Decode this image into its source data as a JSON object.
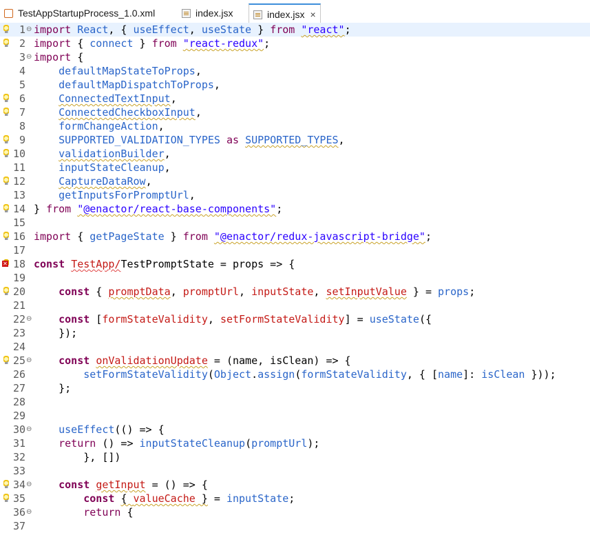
{
  "tabs": [
    {
      "label": "TestAppStartupProcess_1.0.xml",
      "icon": "xml-file-icon",
      "active": false
    },
    {
      "label": "index.jsx",
      "icon": "jsx-file-icon",
      "active": false
    },
    {
      "label": "index.jsx",
      "icon": "jsx-file-icon",
      "active": true,
      "close": "×"
    }
  ],
  "lines": [
    {
      "n": "1",
      "fold": "⊖",
      "marker": "bulb",
      "tokens": [
        [
          "kwn",
          "import"
        ],
        [
          "pl",
          " "
        ],
        [
          "id",
          "React"
        ],
        [
          "pl",
          ", { "
        ],
        [
          "id",
          "useEffect"
        ],
        [
          "pl",
          ", "
        ],
        [
          "id",
          "useState"
        ],
        [
          "pl",
          " } "
        ],
        [
          "kwn",
          "from"
        ],
        [
          "pl",
          " "
        ],
        [
          "str sq",
          "\"react\""
        ],
        [
          "pl",
          ";"
        ]
      ]
    },
    {
      "n": "2",
      "marker": "bulb",
      "tokens": [
        [
          "kwn",
          "import"
        ],
        [
          "pl",
          " { "
        ],
        [
          "id",
          "connect"
        ],
        [
          "pl",
          " } "
        ],
        [
          "kwn",
          "from"
        ],
        [
          "pl",
          " "
        ],
        [
          "str sq",
          "\"react-redux\""
        ],
        [
          "pl",
          ";"
        ]
      ]
    },
    {
      "n": "3",
      "fold": "⊖",
      "tokens": [
        [
          "kwn",
          "import"
        ],
        [
          "pl",
          " {"
        ]
      ]
    },
    {
      "n": "4",
      "tokens": [
        [
          "pl",
          "    "
        ],
        [
          "id",
          "defaultMapStateToProps"
        ],
        [
          "pl",
          ","
        ]
      ]
    },
    {
      "n": "5",
      "tokens": [
        [
          "pl",
          "    "
        ],
        [
          "id",
          "defaultMapDispatchToProps"
        ],
        [
          "pl",
          ","
        ]
      ]
    },
    {
      "n": "6",
      "marker": "bulb",
      "tokens": [
        [
          "pl",
          "    "
        ],
        [
          "id sq",
          "ConnectedTextInput"
        ],
        [
          "pl",
          ","
        ]
      ]
    },
    {
      "n": "7",
      "marker": "bulb",
      "tokens": [
        [
          "pl",
          "    "
        ],
        [
          "id sq",
          "ConnectedCheckboxInput"
        ],
        [
          "pl",
          ","
        ]
      ]
    },
    {
      "n": "8",
      "tokens": [
        [
          "pl",
          "    "
        ],
        [
          "id",
          "formChangeAction"
        ],
        [
          "pl",
          ","
        ]
      ]
    },
    {
      "n": "9",
      "marker": "bulb",
      "tokens": [
        [
          "pl",
          "    "
        ],
        [
          "id",
          "SUPPORTED_VALIDATION_TYPES"
        ],
        [
          "pl",
          " "
        ],
        [
          "kwn",
          "as"
        ],
        [
          "pl",
          " "
        ],
        [
          "id sq",
          "SUPPORTED_TYPES"
        ],
        [
          "pl",
          ","
        ]
      ]
    },
    {
      "n": "10",
      "marker": "bulb",
      "tokens": [
        [
          "pl",
          "    "
        ],
        [
          "id sq",
          "validationBuilder"
        ],
        [
          "pl",
          ","
        ]
      ]
    },
    {
      "n": "11",
      "tokens": [
        [
          "pl",
          "    "
        ],
        [
          "id",
          "inputStateCleanup"
        ],
        [
          "pl",
          ","
        ]
      ]
    },
    {
      "n": "12",
      "marker": "bulb",
      "tokens": [
        [
          "pl",
          "    "
        ],
        [
          "id sq",
          "CaptureDataRow"
        ],
        [
          "pl",
          ","
        ]
      ]
    },
    {
      "n": "13",
      "tokens": [
        [
          "pl",
          "    "
        ],
        [
          "id",
          "getInputsForPromptUrl"
        ],
        [
          "pl",
          ","
        ]
      ]
    },
    {
      "n": "14",
      "marker": "bulb",
      "tokens": [
        [
          "pl",
          "} "
        ],
        [
          "kwn",
          "from"
        ],
        [
          "pl",
          " "
        ],
        [
          "str sq",
          "\"@enactor/react-base-components\""
        ],
        [
          "pl",
          ";"
        ]
      ]
    },
    {
      "n": "15",
      "tokens": []
    },
    {
      "n": "16",
      "marker": "bulb",
      "tokens": [
        [
          "kwn",
          "import"
        ],
        [
          "pl",
          " { "
        ],
        [
          "id",
          "getPageState"
        ],
        [
          "pl",
          " } "
        ],
        [
          "kwn",
          "from"
        ],
        [
          "pl",
          " "
        ],
        [
          "str sq",
          "\"@enactor/redux-javascript-bridge\""
        ],
        [
          "pl",
          ";"
        ]
      ]
    },
    {
      "n": "17",
      "tokens": []
    },
    {
      "n": "18",
      "marker": "error",
      "tokens": [
        [
          "kw",
          "const"
        ],
        [
          "pl",
          " "
        ],
        [
          "err sqr",
          "TestApp/"
        ],
        [
          "pl",
          "TestPromptState = props => {"
        ]
      ]
    },
    {
      "n": "19",
      "tokens": []
    },
    {
      "n": "20",
      "marker": "bulb",
      "tokens": [
        [
          "pl",
          "    "
        ],
        [
          "kw",
          "const"
        ],
        [
          "pl",
          " { "
        ],
        [
          "err sq",
          "promptData"
        ],
        [
          "pl",
          ", "
        ],
        [
          "err",
          "promptUrl"
        ],
        [
          "pl",
          ", "
        ],
        [
          "err",
          "inputState"
        ],
        [
          "pl",
          ", "
        ],
        [
          "err sq",
          "setInputValue"
        ],
        [
          "pl",
          " } = "
        ],
        [
          "id",
          "props"
        ],
        [
          "pl",
          ";"
        ]
      ]
    },
    {
      "n": "21",
      "tokens": []
    },
    {
      "n": "22",
      "fold": "⊖",
      "tokens": [
        [
          "pl",
          "    "
        ],
        [
          "kw",
          "const"
        ],
        [
          "pl",
          " ["
        ],
        [
          "err",
          "formStateValidity"
        ],
        [
          "pl",
          ", "
        ],
        [
          "err",
          "setFormStateValidity"
        ],
        [
          "pl",
          "] = "
        ],
        [
          "id",
          "useState"
        ],
        [
          "pl",
          "({"
        ]
      ]
    },
    {
      "n": "23",
      "tokens": [
        [
          "pl",
          "    });"
        ]
      ]
    },
    {
      "n": "24",
      "tokens": []
    },
    {
      "n": "25",
      "fold": "⊖",
      "marker": "bulb",
      "tokens": [
        [
          "pl",
          "    "
        ],
        [
          "kw",
          "const"
        ],
        [
          "pl",
          " "
        ],
        [
          "err sq",
          "onValidationUpdate"
        ],
        [
          "pl",
          " = (name, isClean) => {"
        ]
      ]
    },
    {
      "n": "26",
      "tokens": [
        [
          "pl",
          "        "
        ],
        [
          "id",
          "setFormStateValidity"
        ],
        [
          "pl",
          "("
        ],
        [
          "id",
          "Object"
        ],
        [
          "pl",
          "."
        ],
        [
          "id",
          "assign"
        ],
        [
          "pl",
          "("
        ],
        [
          "id",
          "formStateValidity"
        ],
        [
          "pl",
          ", { ["
        ],
        [
          "id",
          "name"
        ],
        [
          "pl",
          "]: "
        ],
        [
          "id",
          "isClean"
        ],
        [
          "pl",
          " }));"
        ]
      ]
    },
    {
      "n": "27",
      "tokens": [
        [
          "pl",
          "    };"
        ]
      ]
    },
    {
      "n": "28",
      "tokens": []
    },
    {
      "n": "29",
      "tokens": []
    },
    {
      "n": "30",
      "fold": "⊖",
      "tokens": [
        [
          "pl",
          "    "
        ],
        [
          "id",
          "useEffect"
        ],
        [
          "pl",
          "(() => {"
        ]
      ]
    },
    {
      "n": "31",
      "tokens": [
        [
          "pl",
          "    "
        ],
        [
          "kwn",
          "return"
        ],
        [
          "pl",
          " () => "
        ],
        [
          "id",
          "inputStateCleanup"
        ],
        [
          "pl",
          "("
        ],
        [
          "id",
          "promptUrl"
        ],
        [
          "pl",
          ");"
        ]
      ]
    },
    {
      "n": "32",
      "tokens": [
        [
          "pl",
          "        }, [])"
        ]
      ]
    },
    {
      "n": "33",
      "tokens": []
    },
    {
      "n": "34",
      "fold": "⊖",
      "marker": "bulb",
      "tokens": [
        [
          "pl",
          "    "
        ],
        [
          "kw",
          "const"
        ],
        [
          "pl",
          " "
        ],
        [
          "err sq",
          "getInput"
        ],
        [
          "pl",
          " = () => {"
        ]
      ]
    },
    {
      "n": "35",
      "marker": "bulb",
      "tokens": [
        [
          "pl",
          "        "
        ],
        [
          "kw",
          "const"
        ],
        [
          "pl",
          " "
        ],
        [
          "pl sq",
          "{ "
        ],
        [
          "err sq",
          "valueCache"
        ],
        [
          "pl sq",
          " }"
        ],
        [
          "pl",
          " = "
        ],
        [
          "id",
          "inputState"
        ],
        [
          "pl",
          ";"
        ]
      ]
    },
    {
      "n": "36",
      "fold": "⊖",
      "tokens": [
        [
          "pl",
          "        "
        ],
        [
          "kwn",
          "return"
        ],
        [
          "pl",
          " {"
        ]
      ]
    },
    {
      "n": "37",
      "tokens": []
    }
  ]
}
